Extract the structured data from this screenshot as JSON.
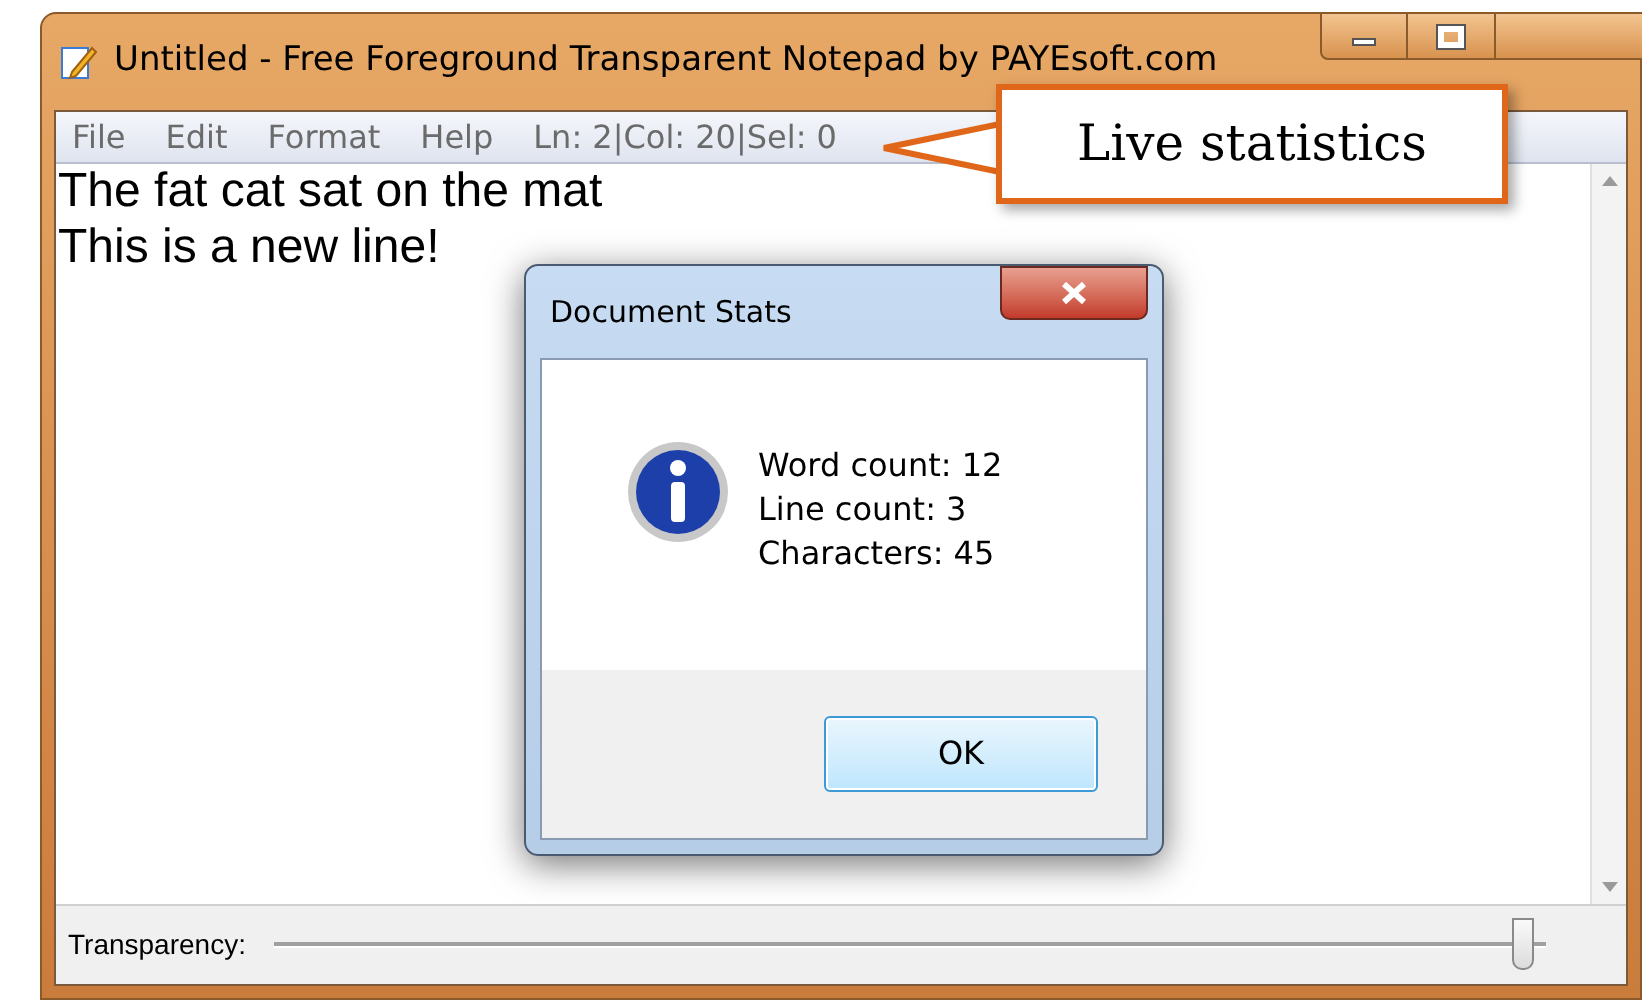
{
  "window": {
    "title": "Untitled - Free Foreground Transparent Notepad by PAYEsoft.com"
  },
  "menu": [
    "File",
    "Edit",
    "Format",
    "Help"
  ],
  "status": "Ln: 2|Col: 20|Sel: 0",
  "callout": "Live statistics",
  "editor": {
    "lines": [
      "The fat cat sat on the mat",
      "This is a new line!"
    ]
  },
  "transparency": {
    "label": "Transparency:",
    "level": 0.99
  },
  "dialog": {
    "title": "Document Stats",
    "lines": [
      "Word count: 12",
      "Line count: 3",
      "Characters: 45"
    ],
    "button": "OK"
  }
}
